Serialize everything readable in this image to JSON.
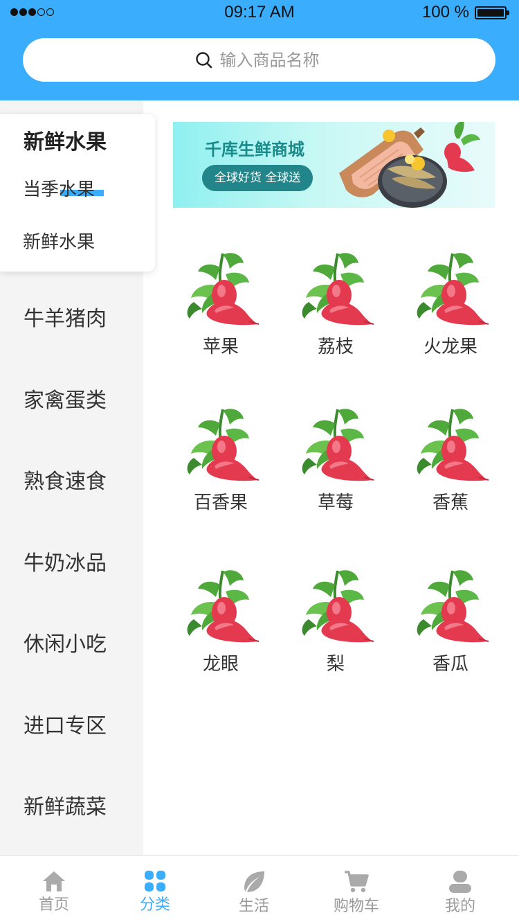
{
  "status_bar": {
    "time": "09:17 AM",
    "battery": "100 %"
  },
  "search": {
    "placeholder": "输入商品名称"
  },
  "popover": {
    "title": "新鲜水果",
    "items": [
      "当季水果",
      "新鲜水果"
    ]
  },
  "sidebar": {
    "items": [
      "牛羊猪肉",
      "家禽蛋类",
      "熟食速食",
      "牛奶冰品",
      "休闲小吃",
      "进口专区",
      "新鲜蔬菜"
    ]
  },
  "banner": {
    "title": "千库生鲜商城",
    "pill": "全球好货 全球送"
  },
  "products": [
    "苹果",
    "荔枝",
    "火龙果",
    "百香果",
    "草莓",
    "香蕉",
    "龙眼",
    "梨",
    "香瓜"
  ],
  "tabbar": {
    "items": [
      {
        "label": "首页",
        "icon": "home-icon",
        "active": false
      },
      {
        "label": "分类",
        "icon": "category-icon",
        "active": true
      },
      {
        "label": "生活",
        "icon": "leaf-icon",
        "active": false
      },
      {
        "label": "购物车",
        "icon": "cart-icon",
        "active": false
      },
      {
        "label": "我的",
        "icon": "user-icon",
        "active": false
      }
    ]
  },
  "colors": {
    "primary": "#3aaefc",
    "sidebar_bg": "#f4f4f4",
    "inactive_tab": "#999999"
  }
}
